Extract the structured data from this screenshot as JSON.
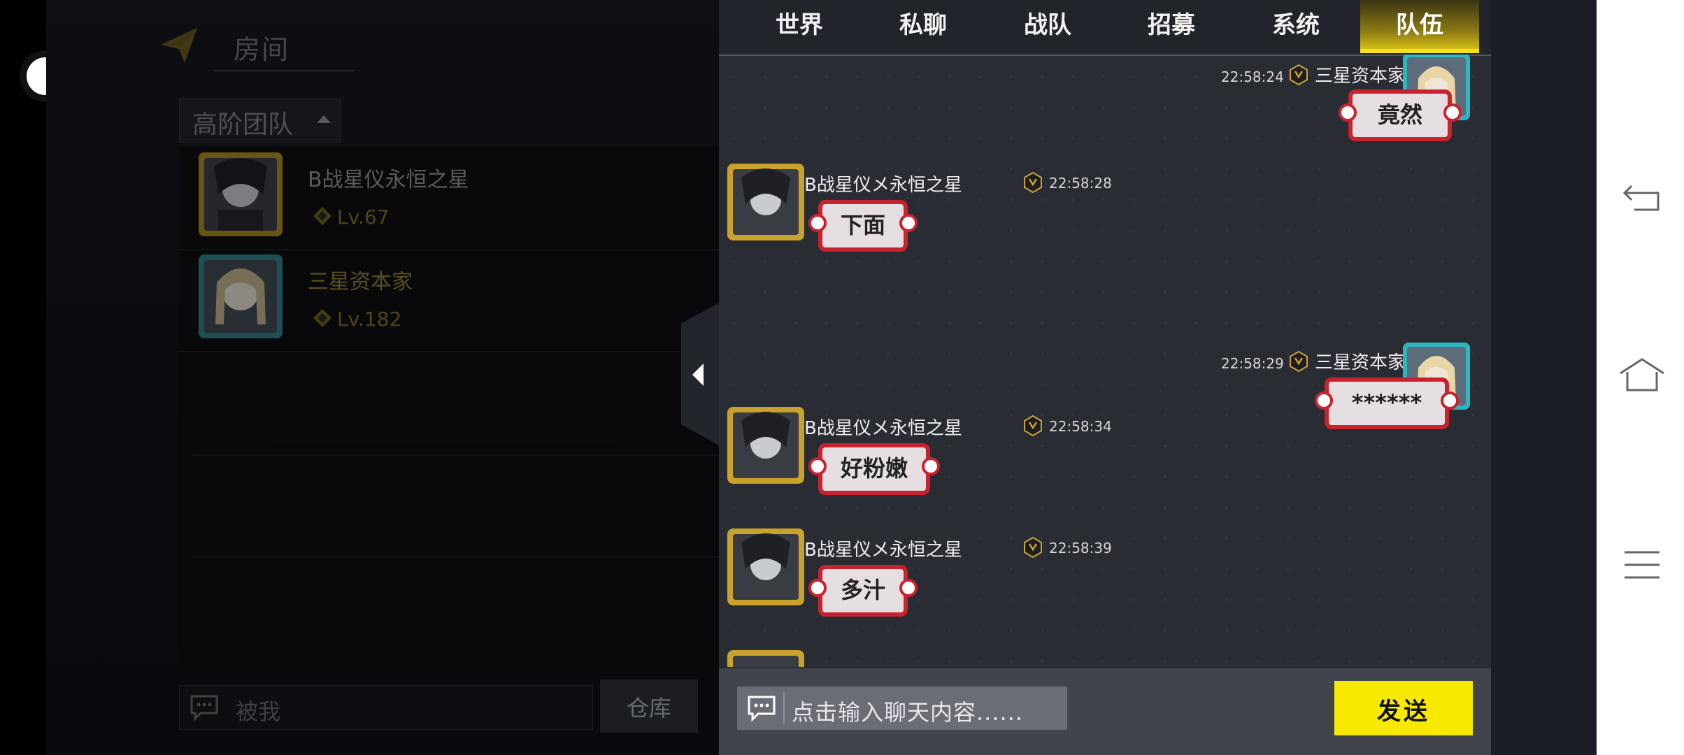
{
  "room": {
    "title": "房间"
  },
  "team": {
    "dropdown_label": "高阶团队"
  },
  "members": [
    {
      "name": "B战星仪永恒之星",
      "level": "Lv.67",
      "name_color": "#8a8c92"
    },
    {
      "name": "三星资本家",
      "level": "Lv.182",
      "name_color": "#8c7a2d"
    }
  ],
  "left_input": {
    "value": "被我"
  },
  "warehouse": {
    "label": "仓库"
  },
  "tabs": [
    {
      "label": "世界",
      "active": false
    },
    {
      "label": "私聊",
      "active": false
    },
    {
      "label": "战队",
      "active": false
    },
    {
      "label": "招募",
      "active": false
    },
    {
      "label": "系统",
      "active": false
    },
    {
      "label": "队伍",
      "active": true
    }
  ],
  "messages": [
    {
      "sender": "三星资本家",
      "time": "22:58:24",
      "text": "竟然",
      "side": "right"
    },
    {
      "sender": "B战星仪メ永恒之星",
      "time": "22:58:28",
      "text": "下面",
      "side": "left"
    },
    {
      "sender": "三星资本家",
      "time": "22:58:29",
      "text": "******",
      "side": "right"
    },
    {
      "sender": "B战星仪メ永恒之星",
      "time": "22:58:34",
      "text": "好粉嫩",
      "side": "left"
    },
    {
      "sender": "B战星仪メ永恒之星",
      "time": "22:58:39",
      "text": "多汁",
      "side": "left"
    }
  ],
  "chat_input": {
    "placeholder": "点击输入聊天内容......"
  },
  "send": {
    "label": "发送"
  },
  "colors": {
    "accent": "#f7ea00",
    "bubble_border": "#c8222e"
  }
}
